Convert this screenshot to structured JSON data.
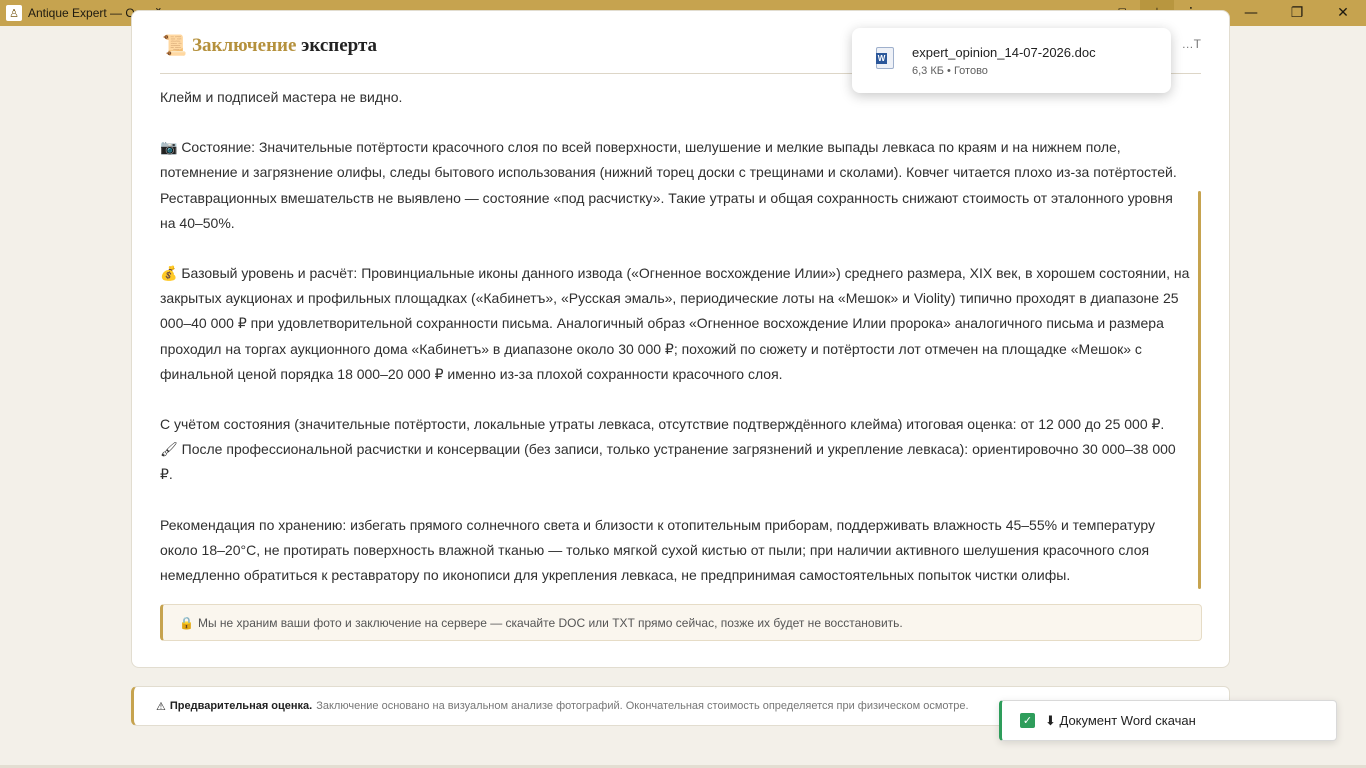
{
  "window": {
    "title": "Antique Expert — Онлайн оценка антиквариата",
    "app_icon": "bell-icon",
    "extensions_icon": "puzzle-icon",
    "download_icon": "download-icon",
    "menu_icon": "more-vertical-icon",
    "minimize": "—",
    "maximize": "❐",
    "close": "✕"
  },
  "card": {
    "icon": "📜",
    "title_accent": "Заключение",
    "title_rest": "эксперта",
    "hidden_actions": "…T",
    "paragraphs": [
      "Клейм и подписей мастера не видно.",
      "📷 Состояние: Значительные потёртости красочного слоя по всей поверхности, шелушение и мелкие выпады левкаса по краям и на нижнем поле, потемнение и загрязнение олифы, следы бытового использования (нижний торец доски с трещинами и сколами). Ковчег читается плохо из-за потёртостей. Реставрационных вмешательств не выявлено — состояние «под расчистку». Такие утраты и общая сохранность снижают стоимость от эталонного уровня на 40–50%.",
      "💰 Базовый уровень и расчёт: Провинциальные иконы данного извода («Огненное восхождение Илии») среднего размера, XIX век, в хорошем состоянии, на закрытых аукционах и профильных площадках («Кабинетъ», «Русская эмаль», периодические лоты на «Мешок» и Violity) типично проходят в диапазоне 25 000–40 000 ₽ при удовлетворительной сохранности письма. Аналогичный образ «Огненное восхождение Илии пророка» аналогичного письма и размера проходил на торгах аукционного дома «Кабинетъ» в диапазоне около 30 000 ₽; похожий по сюжету и потёртости лот отмечен на площадке «Мешок» с финальной ценой порядка 18 000–20 000 ₽ именно из-за плохой сохранности красочного слоя.",
      "С учётом состояния (значительные потёртости, локальные утраты левкаса, отсутствие подтверждённого клейма) итоговая оценка: от 12 000 до 25 000 ₽.",
      "🖌 После профессиональной расчистки и консервации (без записи, только устранение загрязнений и укрепление левкаса): ориентировочно 30 000–38 000 ₽.",
      "Рекомендация по хранению: избегать прямого солнечного света и близости к отопительным приборам, поддерживать влажность 45–55% и температуру около 18–20°C, не протирать поверхность влажной тканью — только мягкой сухой кистью от пыли; при наличии активного шелушения красочного слоя немедленно обратиться к реставратору по иконописи для укрепления левкаса, не предпринимая самостоятельных попыток чистки олифы."
    ],
    "notice_icon": "🔒",
    "notice": "Мы не храним ваши фото и заключение на сервере — скачайте DOC или TXT прямо сейчас, позже их будет не восстановить."
  },
  "disclaimer": {
    "icon": "⚠",
    "bold": "Предварительная оценка.",
    "text": "Заключение основано на визуальном анализе фотографий. Окончательная стоимость определяется при физическом осмотре."
  },
  "download": {
    "filename": "expert_opinion_14-07-2026.doc",
    "status": "6,3 КБ • Готово",
    "file_badge": "W"
  },
  "toast": {
    "check": "✓",
    "text": "⬇ Документ Word скачан"
  },
  "colors": {
    "accent": "#c6a34f",
    "success": "#2e9d5b",
    "word": "#2b579a"
  }
}
